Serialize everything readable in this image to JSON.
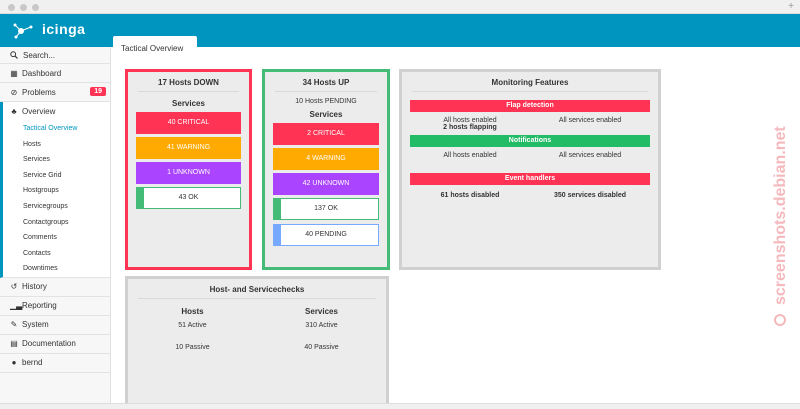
{
  "app": {
    "logo_text": "icinga",
    "active_tab": "Tactical Overview"
  },
  "sidebar": {
    "search_placeholder": "Search...",
    "items": [
      {
        "label": "Dashboard",
        "icon": "dashboard-icon"
      },
      {
        "label": "Problems",
        "icon": "problems-icon",
        "badge": "19"
      },
      {
        "label": "Overview",
        "icon": "overview-icon"
      }
    ],
    "overview_children": [
      "Tactical Overview",
      "Hosts",
      "Services",
      "Service Grid",
      "Hostgroups",
      "Servicegroups",
      "Contactgroups",
      "Comments",
      "Contacts",
      "Downtimes"
    ],
    "bottom_items": [
      {
        "label": "History",
        "icon": "history-icon"
      },
      {
        "label": "Reporting",
        "icon": "reporting-icon"
      },
      {
        "label": "System",
        "icon": "wrench-icon"
      },
      {
        "label": "Documentation",
        "icon": "book-icon"
      },
      {
        "label": "bernd",
        "icon": "user-icon"
      }
    ]
  },
  "hosts_down": {
    "title": "17 Hosts DOWN",
    "services_label": "Services",
    "critical": "40 CRITICAL",
    "warning": "41 WARNING",
    "unknown": "1 UNKNOWN",
    "ok": "43 OK"
  },
  "hosts_up": {
    "title": "34 Hosts UP",
    "pending_hosts": "10 Hosts PENDING",
    "services_label": "Services",
    "critical": "2 CRITICAL",
    "warning": "4 WARNING",
    "unknown": "42 UNKNOWN",
    "ok": "137 OK",
    "pending": "40 PENDING"
  },
  "monitoring": {
    "title": "Monitoring Features",
    "flap": {
      "header": "Flap detection",
      "hosts": "All hosts enabled",
      "services": "All services enabled",
      "hosts_extra": "2 hosts flapping"
    },
    "notifications": {
      "header": "Notifications",
      "hosts": "All hosts enabled",
      "services": "All services enabled"
    },
    "events": {
      "header": "Event handlers",
      "hosts": "61 hosts disabled",
      "services": "350 services disabled"
    }
  },
  "checks": {
    "title": "Host- and Servicechecks",
    "hosts_label": "Hosts",
    "services_label": "Services",
    "hosts_active": "51 Active",
    "services_active": "310 Active",
    "hosts_passive": "10 Passive",
    "services_passive": "40 Passive"
  },
  "watermark": "screenshots.debian.net",
  "colors": {
    "brand": "#0095bf",
    "critical": "#ff3354",
    "warning": "#ffaa00",
    "unknown": "#aa44ff",
    "ok": "#44bb77",
    "pending": "#77aaff"
  }
}
